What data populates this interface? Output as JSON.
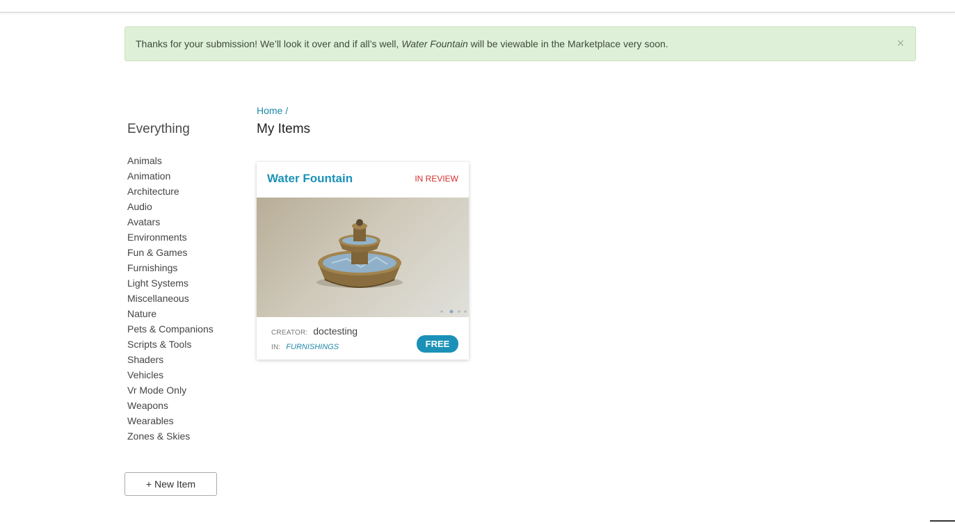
{
  "alert": {
    "text_before": "Thanks for your submission! We’ll look it over and if all’s well, ",
    "item_name": "Water Fountain",
    "text_after": " will be viewable in the Marketplace very soon.",
    "close": "×"
  },
  "sidebar": {
    "title": "Everything",
    "items": [
      {
        "label": "Animals"
      },
      {
        "label": "Animation"
      },
      {
        "label": "Architecture"
      },
      {
        "label": "Audio"
      },
      {
        "label": "Avatars"
      },
      {
        "label": "Environments"
      },
      {
        "label": "Fun & Games"
      },
      {
        "label": "Furnishings"
      },
      {
        "label": "Light Systems"
      },
      {
        "label": "Miscellaneous"
      },
      {
        "label": "Nature"
      },
      {
        "label": "Pets & Companions"
      },
      {
        "label": "Scripts & Tools"
      },
      {
        "label": "Shaders"
      },
      {
        "label": "Vehicles"
      },
      {
        "label": "Vr Mode Only"
      },
      {
        "label": "Weapons"
      },
      {
        "label": "Wearables"
      },
      {
        "label": "Zones & Skies"
      }
    ],
    "new_item_label": "+ New Item"
  },
  "breadcrumb": {
    "home": "Home",
    "separator": "/"
  },
  "page": {
    "title": "My Items"
  },
  "card": {
    "title": "Water Fountain",
    "status": "IN REVIEW",
    "creator_label": "CREATOR:",
    "creator": "doctesting",
    "category_label": "IN:",
    "category": "FURNISHINGS",
    "price": "FREE"
  },
  "colors": {
    "accent": "#1b91b7",
    "status_review": "#d62d2d",
    "alert_bg": "#dff0d8"
  },
  "icons": {
    "close": "close-icon",
    "thumbnail": "fountain-thumbnail"
  }
}
